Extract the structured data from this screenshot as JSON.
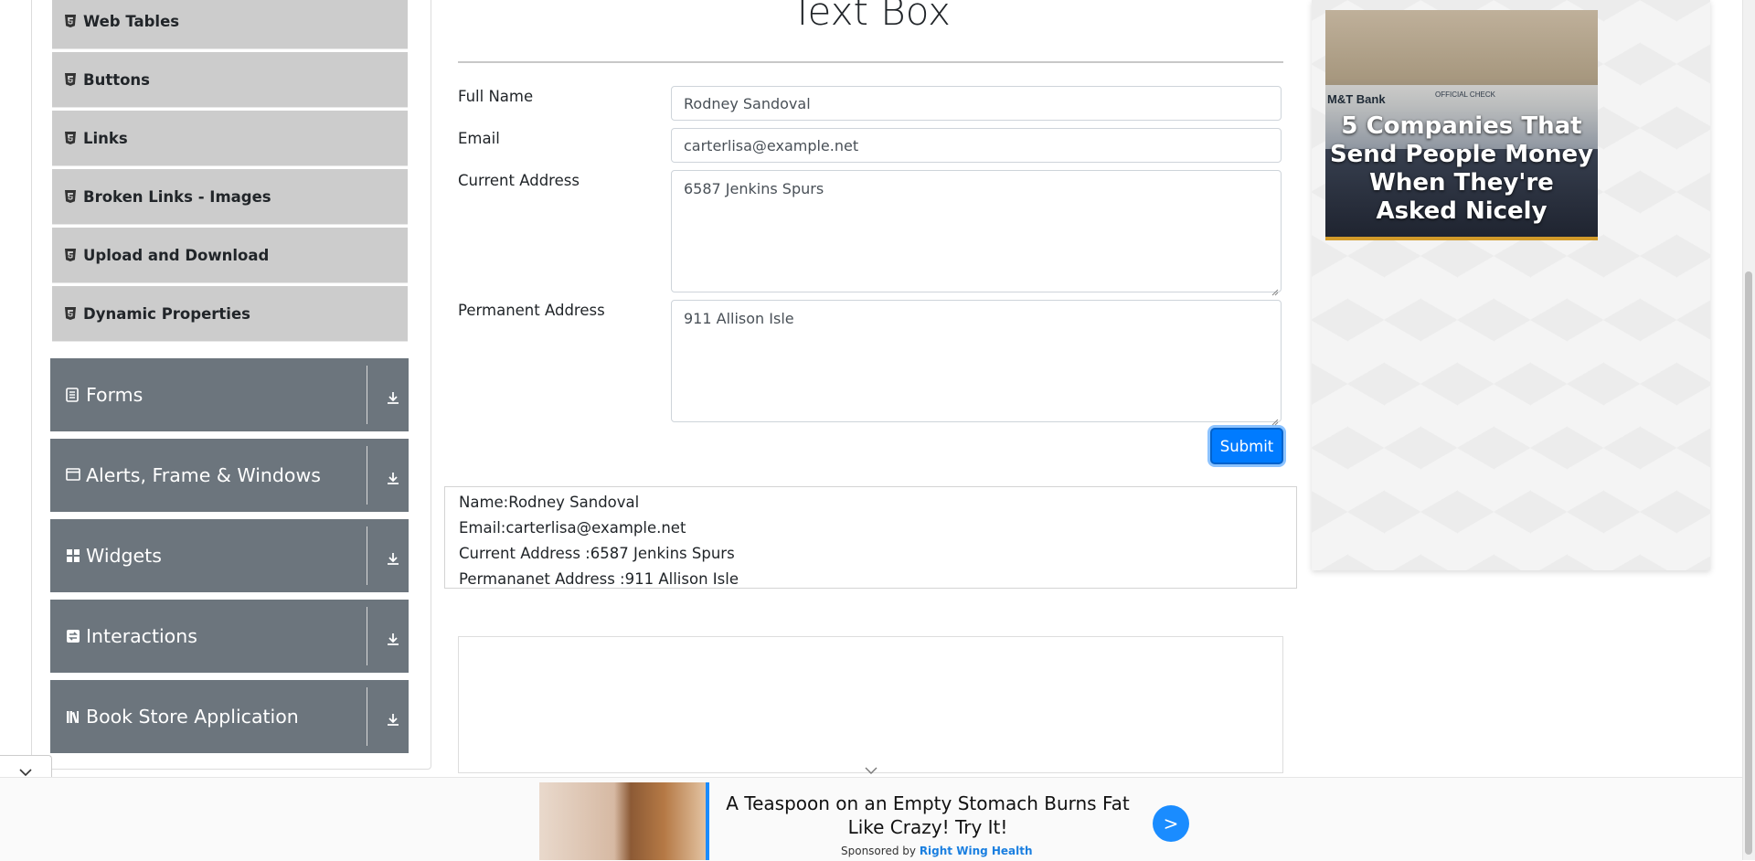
{
  "sidebar": {
    "elements_items": [
      {
        "label": "Web Tables"
      },
      {
        "label": "Buttons"
      },
      {
        "label": "Links"
      },
      {
        "label": "Broken Links - Images"
      },
      {
        "label": "Upload and Download"
      },
      {
        "label": "Dynamic Properties"
      }
    ],
    "groups": [
      {
        "label": "Forms",
        "icon": "form-icon"
      },
      {
        "label": "Alerts, Frame & Windows",
        "icon": "window-icon"
      },
      {
        "label": "Widgets",
        "icon": "widgets-icon"
      },
      {
        "label": "Interactions",
        "icon": "interactions-icon"
      },
      {
        "label": "Book Store Application",
        "icon": "books-icon"
      }
    ]
  },
  "form": {
    "title": "Text Box",
    "full_name_label": "Full Name",
    "full_name_value": "Rodney Sandoval",
    "email_label": "Email",
    "email_value": "carterlisa@example.net",
    "current_address_label": "Current Address",
    "current_address_value": "6587 Jenkins Spurs",
    "permanent_address_label": "Permanent Address",
    "permanent_address_value": "911 Allison Isle",
    "submit_label": "Submit"
  },
  "output": {
    "name": "Name:Rodney Sandoval",
    "email": "Email:carterlisa@example.net",
    "current_address": "Current Address :6587 Jenkins Spurs",
    "permanent_address": "Permananet Address :911 Allison Isle"
  },
  "right_ad": {
    "bank_text": "M&T Bank",
    "check_text": "OFFICIAL CHECK",
    "headline": "5 Companies That Send People Money When They're Asked Nicely"
  },
  "bottom_ad": {
    "headline": "A Teaspoon on an Empty Stomach Burns Fat Like Crazy! Try It!",
    "sponsor_prefix": "Sponsored by",
    "sponsor_name": "Right Wing Health",
    "go_label": ">"
  },
  "colors": {
    "primary": "#007bff",
    "group_header": "#6c757d",
    "menu_item": "#cccccc"
  }
}
